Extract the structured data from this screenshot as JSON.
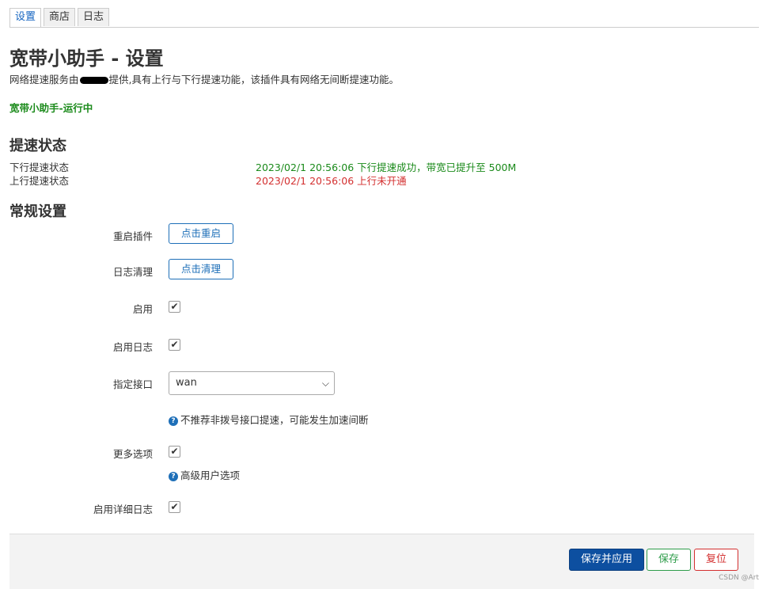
{
  "tabs": [
    "设置",
    "商店",
    "日志"
  ],
  "page": {
    "title": "宽带小助手 - 设置",
    "desc_pre": "网络提速服务由",
    "desc_post": "提供,具有上行与下行提速功能，该插件具有网络无间断提速功能。",
    "running": "宽带小助手-运行中"
  },
  "status": {
    "heading": "提速状态",
    "down_label": "下行提速状态",
    "down_value": "2023/02/1 20:56:06 下行提速成功，带宽已提升至 500M",
    "up_label": "上行提速状态",
    "up_value": "2023/02/1 20:56:06 上行未开通",
    "ok_color": "#1a8a1a",
    "bad_color": "#d32f2f"
  },
  "settings": {
    "heading": "常规设置",
    "restart_label": "重启插件",
    "restart_button": "点击重启",
    "clean_label": "日志清理",
    "clean_button": "点击清理",
    "enable_label": "启用",
    "enable_checked": true,
    "log_label": "启用日志",
    "log_checked": true,
    "iface_label": "指定接口",
    "iface_value": "wan",
    "iface_hint": "不推荐非拨号接口提速，可能发生加速间断",
    "more_label": "更多选项",
    "more_checked": true,
    "more_hint": "高级用户选项",
    "verbose_label": "启用详细日志",
    "verbose_checked": true
  },
  "footer": {
    "save_apply": "保存并应用",
    "save": "保存",
    "reset": "复位"
  },
  "watermark": "CSDN @Art",
  "icons": {
    "help": "help-icon",
    "check": "check-icon",
    "chevron": "chevron-down-icon"
  }
}
